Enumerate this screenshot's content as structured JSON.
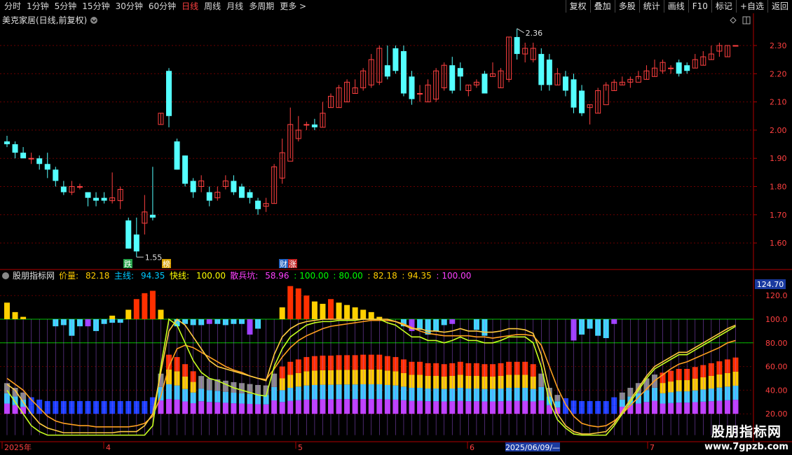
{
  "toolbar": {
    "periods": [
      "分时",
      "1分钟",
      "5分钟",
      "15分钟",
      "30分钟",
      "60分钟",
      "日线",
      "周线",
      "月线",
      "多周期",
      "更多 >"
    ],
    "active_period": "日线",
    "buttons": [
      "复权",
      "叠加",
      "多股",
      "统计",
      "画线",
      "F10",
      "标记",
      "+自选",
      "返回"
    ]
  },
  "main_panel": {
    "title": "美克家居(日线,前复权)",
    "high_label": "2.36",
    "low_label": "1.55",
    "price_axis": [
      "2.30",
      "2.20",
      "2.10",
      "2.00",
      "1.90",
      "1.80",
      "1.70",
      "1.60"
    ],
    "badges": [
      {
        "text": "跌",
        "color": "#22a046"
      },
      {
        "text": "榜",
        "color": "#d8a000"
      },
      {
        "text": "财",
        "color": "#2060c0"
      },
      {
        "text": "涨",
        "color": "#c02020"
      }
    ]
  },
  "indicator_panel": {
    "name": "股朋指标网",
    "readouts": [
      {
        "label": "价量:",
        "value": "82.18",
        "color": "#ffcc00"
      },
      {
        "label": "主线:",
        "value": "94.35",
        "color": "#00c8ff"
      },
      {
        "label": "快线:",
        "value": "100.00",
        "color": "#ffff00"
      },
      {
        "label": "散兵坑:",
        "value": "58.96",
        "color": "#ff40ff"
      },
      {
        "label": ":",
        "value": "100.00",
        "color": "#00ff00"
      },
      {
        "label": ":",
        "value": "80.00",
        "color": "#00ff00"
      },
      {
        "label": ":",
        "value": "82.18",
        "color": "#ffcc00"
      },
      {
        "label": ":",
        "value": "94.35",
        "color": "#ffcc00"
      },
      {
        "label": ":",
        "value": "100.00",
        "color": "#ff40ff"
      }
    ],
    "axis_box": "124.70",
    "axis": [
      "120.0",
      "100.0",
      "80.00",
      "60.00",
      "40.00",
      "20.00"
    ]
  },
  "date_axis": {
    "labels": [
      "2025年",
      "4",
      "5",
      "6",
      "7"
    ],
    "cursor_label": "2025/06/09/—"
  },
  "watermark": {
    "line1": "股朋指标网",
    "line2": "www.7gpzb.com"
  },
  "colors": {
    "up": "#ff4040",
    "down": "#54ffff",
    "grid": "#8b0000",
    "axis_text": "#ff4040"
  },
  "chart_data": {
    "type": "candlestick",
    "open": [
      1.96,
      1.95,
      1.92,
      1.9,
      1.9,
      1.88,
      1.86,
      1.8,
      1.78,
      1.8,
      1.78,
      1.76,
      1.76,
      1.75,
      1.75,
      1.68,
      1.63,
      1.67,
      1.7,
      2.02,
      2.21,
      1.96,
      1.91,
      1.82,
      1.8,
      1.78,
      1.76,
      1.8,
      1.82,
      1.8,
      1.78,
      1.75,
      1.73,
      1.74,
      1.83,
      1.89,
      1.97,
      2.02,
      2.02,
      2.01,
      2.08,
      2.08,
      2.1,
      2.13,
      2.15,
      2.16,
      2.17,
      2.23,
      2.29,
      2.28,
      2.19,
      2.13,
      2.1,
      2.11,
      2.15,
      2.23,
      2.22,
      2.14,
      2.16,
      2.2,
      2.19,
      2.15,
      2.18,
      2.33,
      2.27,
      2.25,
      2.27,
      2.25,
      2.16,
      2.19,
      2.18,
      2.14,
      2.08,
      2.06,
      2.09,
      2.14,
      2.16,
      2.17,
      2.17,
      2.18,
      2.19,
      2.21,
      2.22,
      2.24,
      2.23,
      2.22,
      2.23,
      2.25,
      2.28,
      2.26,
      2.3
    ],
    "close": [
      1.95,
      1.92,
      1.9,
      1.9,
      1.88,
      1.86,
      1.82,
      1.78,
      1.8,
      1.8,
      1.76,
      1.75,
      1.75,
      1.76,
      1.79,
      1.58,
      1.57,
      1.71,
      1.69,
      2.06,
      2.05,
      1.86,
      1.81,
      1.78,
      1.82,
      1.75,
      1.78,
      1.82,
      1.78,
      1.76,
      1.76,
      1.72,
      1.74,
      1.87,
      1.92,
      2.02,
      2.0,
      2.02,
      2.01,
      2.06,
      2.12,
      2.15,
      2.17,
      2.15,
      2.21,
      2.25,
      2.29,
      2.19,
      2.21,
      2.13,
      2.11,
      2.13,
      2.16,
      2.21,
      2.23,
      2.14,
      2.19,
      2.16,
      2.17,
      2.13,
      2.2,
      2.21,
      2.33,
      2.27,
      2.29,
      2.29,
      2.16,
      2.16,
      2.2,
      2.14,
      2.08,
      2.06,
      2.09,
      2.14,
      2.16,
      2.17,
      2.17,
      2.18,
      2.19,
      2.21,
      2.22,
      2.24,
      2.22,
      2.2,
      2.21,
      2.25,
      2.26,
      2.27,
      2.3,
      2.3,
      2.3
    ],
    "high": [
      1.98,
      1.96,
      1.94,
      1.92,
      1.91,
      1.92,
      1.87,
      1.82,
      1.82,
      1.81,
      1.78,
      1.78,
      1.78,
      1.85,
      1.8,
      1.69,
      1.69,
      1.77,
      1.87,
      2.06,
      2.22,
      1.97,
      1.91,
      1.83,
      1.84,
      1.8,
      1.8,
      1.84,
      1.84,
      1.81,
      1.79,
      1.76,
      1.76,
      1.88,
      1.97,
      2.08,
      2.05,
      2.03,
      2.04,
      2.1,
      2.13,
      2.16,
      2.18,
      2.18,
      2.22,
      2.27,
      2.3,
      2.3,
      2.3,
      2.3,
      2.21,
      2.16,
      2.18,
      2.22,
      2.24,
      2.26,
      2.24,
      2.16,
      2.18,
      2.21,
      2.24,
      2.22,
      2.33,
      2.36,
      2.31,
      2.31,
      2.29,
      2.27,
      2.22,
      2.21,
      2.2,
      2.16,
      2.09,
      2.15,
      2.17,
      2.18,
      2.19,
      2.19,
      2.21,
      2.23,
      2.25,
      2.25,
      2.23,
      2.25,
      2.24,
      2.27,
      2.28,
      2.3,
      2.31,
      2.3,
      2.3
    ],
    "low": [
      1.94,
      1.9,
      1.9,
      1.88,
      1.86,
      1.83,
      1.8,
      1.77,
      1.77,
      1.79,
      1.73,
      1.73,
      1.74,
      1.74,
      1.72,
      1.58,
      1.55,
      1.63,
      1.68,
      2.02,
      2.01,
      1.86,
      1.8,
      1.76,
      1.78,
      1.73,
      1.75,
      1.79,
      1.77,
      1.76,
      1.74,
      1.7,
      1.71,
      1.74,
      1.81,
      1.9,
      1.96,
      2.0,
      2.0,
      2.01,
      2.08,
      2.08,
      2.1,
      2.13,
      2.14,
      2.15,
      2.16,
      2.18,
      2.2,
      2.12,
      2.09,
      2.1,
      2.1,
      2.1,
      2.14,
      2.13,
      2.14,
      2.12,
      2.15,
      2.13,
      2.19,
      2.15,
      2.17,
      2.25,
      2.24,
      2.24,
      2.14,
      2.14,
      2.16,
      2.12,
      2.06,
      2.05,
      2.02,
      2.06,
      2.14,
      2.14,
      2.16,
      2.15,
      2.18,
      2.18,
      2.19,
      2.2,
      2.2,
      2.19,
      2.2,
      2.22,
      2.23,
      2.25,
      2.26,
      2.26,
      2.3
    ],
    "bars_above": [
      14,
      6,
      2,
      0,
      0,
      0,
      0,
      0,
      0,
      0,
      0,
      0,
      0,
      3,
      0,
      8,
      17,
      22,
      24,
      8,
      0,
      0,
      0,
      0,
      0,
      0,
      0,
      0,
      0,
      0,
      0,
      0,
      0,
      0,
      10,
      28,
      26,
      20,
      15,
      13,
      17,
      14,
      12,
      10,
      8,
      6,
      2,
      0,
      0,
      0,
      0,
      0,
      0,
      0,
      0,
      0,
      0,
      0,
      0,
      0,
      0,
      0,
      0,
      0,
      0,
      0,
      0,
      0,
      0,
      0,
      0,
      0,
      0,
      0,
      0,
      0,
      0,
      0,
      0,
      0,
      0,
      0,
      0,
      0,
      0,
      0,
      0,
      0,
      0,
      0,
      0
    ],
    "bars_below": [
      0,
      0,
      0,
      0,
      0,
      0,
      6,
      5,
      14,
      6,
      6,
      10,
      4,
      3,
      3,
      0,
      0,
      0,
      0,
      0,
      0,
      6,
      4,
      5,
      5,
      4,
      4,
      5,
      4,
      4,
      13,
      8,
      0,
      0,
      0,
      0,
      0,
      0,
      0,
      0,
      0,
      0,
      0,
      0,
      0,
      0,
      0,
      0,
      0,
      6,
      10,
      9,
      13,
      10,
      5,
      4,
      0,
      0,
      9,
      14,
      0,
      0,
      0,
      0,
      0,
      0,
      0,
      0,
      0,
      0,
      18,
      13,
      8,
      14,
      16,
      4,
      0,
      0,
      0,
      0,
      0,
      0,
      0,
      0,
      0,
      0,
      0,
      0,
      0,
      0,
      0
    ],
    "main_line": [
      40,
      30,
      20,
      10,
      5,
      2,
      2,
      2,
      2,
      2,
      2,
      2,
      2,
      2,
      2,
      2,
      2,
      2,
      10,
      60,
      100,
      95,
      80,
      65,
      55,
      50,
      48,
      45,
      42,
      40,
      38,
      36,
      35,
      60,
      75,
      85,
      90,
      95,
      97,
      98,
      98,
      99,
      99,
      99,
      100,
      100,
      100,
      97,
      95,
      90,
      85,
      85,
      82,
      82,
      80,
      82,
      85,
      82,
      82,
      80,
      80,
      82,
      85,
      85,
      85,
      80,
      60,
      30,
      15,
      8,
      3,
      2,
      2,
      2,
      2,
      10,
      20,
      30,
      40,
      50,
      58,
      62,
      66,
      70,
      70,
      74,
      78,
      82,
      86,
      90,
      94
    ],
    "fast_line": [
      45,
      40,
      30,
      20,
      12,
      8,
      6,
      4,
      4,
      4,
      4,
      4,
      4,
      4,
      5,
      5,
      5,
      10,
      20,
      55,
      90,
      100,
      95,
      85,
      75,
      65,
      60,
      58,
      56,
      54,
      52,
      50,
      48,
      70,
      85,
      92,
      96,
      98,
      99,
      100,
      100,
      100,
      100,
      100,
      100,
      100,
      100,
      100,
      98,
      95,
      92,
      92,
      90,
      90,
      89,
      90,
      92,
      90,
      90,
      89,
      89,
      90,
      92,
      92,
      91,
      88,
      70,
      40,
      20,
      10,
      5,
      3,
      3,
      4,
      5,
      12,
      22,
      32,
      42,
      52,
      60,
      64,
      68,
      72,
      72,
      76,
      80,
      84,
      88,
      92,
      95
    ],
    "slow_line": [
      50,
      45,
      40,
      32,
      25,
      18,
      14,
      12,
      11,
      10,
      10,
      9,
      9,
      9,
      9,
      9,
      10,
      12,
      18,
      35,
      60,
      75,
      78,
      76,
      72,
      68,
      64,
      60,
      57,
      55,
      52,
      50,
      49,
      58,
      68,
      76,
      82,
      86,
      89,
      92,
      94,
      95,
      96,
      97,
      98,
      99,
      99,
      99,
      98,
      96,
      93,
      90,
      88,
      87,
      86,
      86,
      86,
      86,
      85,
      85,
      84,
      85,
      86,
      87,
      87,
      86,
      78,
      60,
      42,
      28,
      18,
      12,
      10,
      9,
      10,
      14,
      20,
      27,
      34,
      41,
      48,
      53,
      58,
      62,
      64,
      67,
      70,
      73,
      76,
      80,
      82
    ]
  }
}
